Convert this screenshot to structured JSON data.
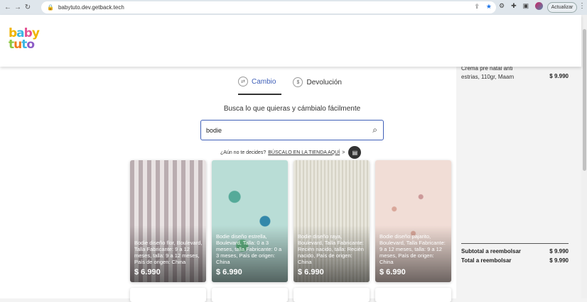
{
  "browser": {
    "url": "babytuto.dev.getback.tech",
    "update_label": "Actualizar"
  },
  "logo": {
    "line1": "baby",
    "line2": "tuto"
  },
  "tabs": [
    {
      "label": "Cambio",
      "icon": "exchange-icon",
      "active": true
    },
    {
      "label": "Devolución",
      "icon": "refund-icon",
      "active": false
    }
  ],
  "main": {
    "subtitle": "Busca lo que quieras y cámbialo fácilmente",
    "search_value": "bodie",
    "undecided_text": "¿Aún no te decides?",
    "undecided_link": "BÚSCALO EN LA TIENDA AQUÍ",
    "undecided_arrow": ">"
  },
  "products": [
    {
      "desc": "Bodie diseño flor, Boulevard, Talla Fabricante: 9 a 12 meses, talla: 9 a 12 meses, País de origen: China",
      "price": "$ 6.990",
      "color": "#cfc2c4"
    },
    {
      "desc": "Bodie diseño estrella, Boulevard, Talla: 0 a 3 meses, talla Fabricante: 0 a 3 meses, País de origen: China",
      "price": "$ 6.990",
      "color": "#9fc9c4"
    },
    {
      "desc": "Bodie diseño raya, Boulevard, Talla Fabricante: Recién nacido, talla: Recién nacido, País de origen: China",
      "price": "$ 6.990",
      "color": "#e2e0d4"
    },
    {
      "desc": "Bodie diseño pajarito, Boulevard, Talla Fabricante: 9 a 12 meses, talla: 9 a 12 meses, País de origen: China",
      "price": "$ 6.990",
      "color": "#ecd6cf"
    }
  ],
  "cart": {
    "item_name": "Crema pre natal anti estrias, 110gr, Maam",
    "item_price": "$ 9.990",
    "subtotal_label": "Subtotal a reembolsar",
    "subtotal_value": "$ 9.990",
    "total_label": "Total a reembolsar",
    "total_value": "$ 9.990"
  }
}
